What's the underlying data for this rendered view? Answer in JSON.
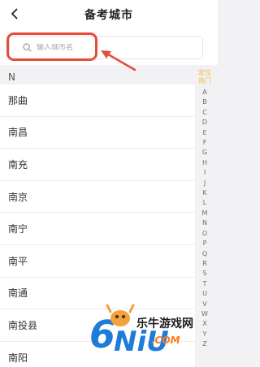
{
  "header": {
    "title": "备考城市",
    "back_icon": "chevron-left-icon"
  },
  "search": {
    "placeholder": "输入城市名",
    "icon": "search-icon"
  },
  "section": {
    "letter": "N"
  },
  "cities": [
    "那曲",
    "南昌",
    "南充",
    "南京",
    "南宁",
    "南平",
    "南通",
    "南投县",
    "南阳"
  ],
  "index": {
    "hot_label_1": "定位",
    "hot_label_2": "热门",
    "letters": [
      "A",
      "B",
      "C",
      "D",
      "E",
      "F",
      "G",
      "H",
      "I",
      "J",
      "K",
      "L",
      "M",
      "N",
      "O",
      "P",
      "Q",
      "R",
      "S",
      "T",
      "U",
      "V",
      "W",
      "X",
      "Y",
      "Z"
    ]
  },
  "watermark": {
    "brand": "乐牛游戏网",
    "domain": ".COM",
    "logo_text": "6NiU"
  },
  "colors": {
    "highlight": "#e54c3c",
    "hot_index": "#f3b43a",
    "watermark_orange": "#ff7a1a",
    "watermark_blue": "#1e7cd8"
  }
}
